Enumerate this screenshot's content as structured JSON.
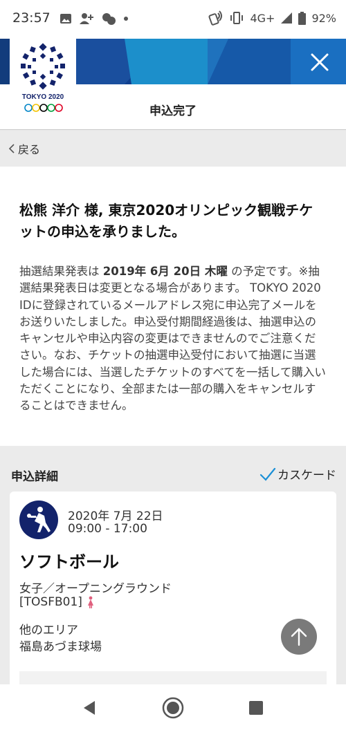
{
  "status_bar": {
    "time": "23:57",
    "network": "4G+",
    "battery": "92%",
    "icons": [
      "image-icon",
      "person-add-icon",
      "chat-bubbles-icon",
      "dot-icon",
      "nfc-icon",
      "vibrate-icon",
      "signal-icon",
      "battery-icon"
    ]
  },
  "header": {
    "logo_text": "TOKYO 2020",
    "title": "申込完了",
    "colors": {
      "banner_dark": "#0f3f8f",
      "banner_mid": "#1c5fb0",
      "banner_light": "#1a95cf"
    }
  },
  "nav": {
    "back_label": "戻る"
  },
  "confirmation": {
    "title": "松熊 洋介 様, 東京2020オリンピック観戦チケットの申込を承りました。",
    "body_pre": "抽選結果発表は ",
    "body_date": "2019年 6月 20日 木曜",
    "body_post": " の予定です。※抽選結果発表日は変更となる場合があります。 TOKYO 2020 IDに登録されているメールアドレス宛に申込完了メールをお送りいたしました。申込受付期間経過後は、抽選申込のキャンセルや申込内容の変更はできませんのでご注意ください。なお、チケットの抽選申込受付において抽選に当選した場合には、当選したチケットのすべてを一括して購入いただくことになり、全部または一部の購入をキャンセルすることはできません。"
  },
  "details": {
    "title": "申込詳細",
    "cascade_label": "カスケード"
  },
  "event": {
    "date": "2020年 7月 22日",
    "time": "09:00 - 17:00",
    "sport": "ソフトボール",
    "round": "女子／オープニングラウンド",
    "code": "[TOSFB01]",
    "area": "他のエリア",
    "venue": "福島あづま球場"
  }
}
